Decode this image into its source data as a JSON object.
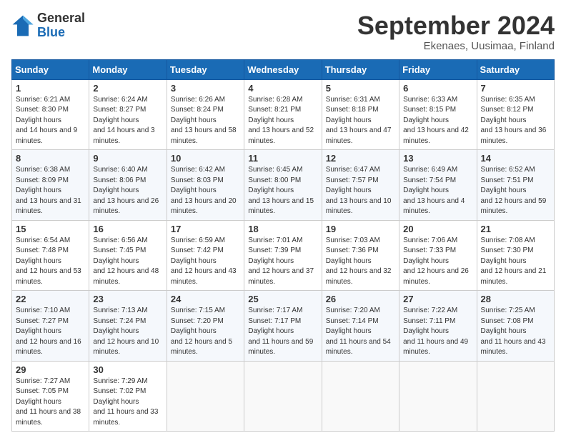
{
  "logo": {
    "general": "General",
    "blue": "Blue"
  },
  "title": {
    "month": "September 2024",
    "location": "Ekenaes, Uusimaa, Finland"
  },
  "headers": [
    "Sunday",
    "Monday",
    "Tuesday",
    "Wednesday",
    "Thursday",
    "Friday",
    "Saturday"
  ],
  "weeks": [
    [
      {
        "day": 1,
        "sunrise": "6:21 AM",
        "sunset": "8:30 PM",
        "daylight": "14 hours and 9 minutes."
      },
      {
        "day": 2,
        "sunrise": "6:24 AM",
        "sunset": "8:27 PM",
        "daylight": "14 hours and 3 minutes."
      },
      {
        "day": 3,
        "sunrise": "6:26 AM",
        "sunset": "8:24 PM",
        "daylight": "13 hours and 58 minutes."
      },
      {
        "day": 4,
        "sunrise": "6:28 AM",
        "sunset": "8:21 PM",
        "daylight": "13 hours and 52 minutes."
      },
      {
        "day": 5,
        "sunrise": "6:31 AM",
        "sunset": "8:18 PM",
        "daylight": "13 hours and 47 minutes."
      },
      {
        "day": 6,
        "sunrise": "6:33 AM",
        "sunset": "8:15 PM",
        "daylight": "13 hours and 42 minutes."
      },
      {
        "day": 7,
        "sunrise": "6:35 AM",
        "sunset": "8:12 PM",
        "daylight": "13 hours and 36 minutes."
      }
    ],
    [
      {
        "day": 8,
        "sunrise": "6:38 AM",
        "sunset": "8:09 PM",
        "daylight": "13 hours and 31 minutes."
      },
      {
        "day": 9,
        "sunrise": "6:40 AM",
        "sunset": "8:06 PM",
        "daylight": "13 hours and 26 minutes."
      },
      {
        "day": 10,
        "sunrise": "6:42 AM",
        "sunset": "8:03 PM",
        "daylight": "13 hours and 20 minutes."
      },
      {
        "day": 11,
        "sunrise": "6:45 AM",
        "sunset": "8:00 PM",
        "daylight": "13 hours and 15 minutes."
      },
      {
        "day": 12,
        "sunrise": "6:47 AM",
        "sunset": "7:57 PM",
        "daylight": "13 hours and 10 minutes."
      },
      {
        "day": 13,
        "sunrise": "6:49 AM",
        "sunset": "7:54 PM",
        "daylight": "13 hours and 4 minutes."
      },
      {
        "day": 14,
        "sunrise": "6:52 AM",
        "sunset": "7:51 PM",
        "daylight": "12 hours and 59 minutes."
      }
    ],
    [
      {
        "day": 15,
        "sunrise": "6:54 AM",
        "sunset": "7:48 PM",
        "daylight": "12 hours and 53 minutes."
      },
      {
        "day": 16,
        "sunrise": "6:56 AM",
        "sunset": "7:45 PM",
        "daylight": "12 hours and 48 minutes."
      },
      {
        "day": 17,
        "sunrise": "6:59 AM",
        "sunset": "7:42 PM",
        "daylight": "12 hours and 43 minutes."
      },
      {
        "day": 18,
        "sunrise": "7:01 AM",
        "sunset": "7:39 PM",
        "daylight": "12 hours and 37 minutes."
      },
      {
        "day": 19,
        "sunrise": "7:03 AM",
        "sunset": "7:36 PM",
        "daylight": "12 hours and 32 minutes."
      },
      {
        "day": 20,
        "sunrise": "7:06 AM",
        "sunset": "7:33 PM",
        "daylight": "12 hours and 26 minutes."
      },
      {
        "day": 21,
        "sunrise": "7:08 AM",
        "sunset": "7:30 PM",
        "daylight": "12 hours and 21 minutes."
      }
    ],
    [
      {
        "day": 22,
        "sunrise": "7:10 AM",
        "sunset": "7:27 PM",
        "daylight": "12 hours and 16 minutes."
      },
      {
        "day": 23,
        "sunrise": "7:13 AM",
        "sunset": "7:24 PM",
        "daylight": "12 hours and 10 minutes."
      },
      {
        "day": 24,
        "sunrise": "7:15 AM",
        "sunset": "7:20 PM",
        "daylight": "12 hours and 5 minutes."
      },
      {
        "day": 25,
        "sunrise": "7:17 AM",
        "sunset": "7:17 PM",
        "daylight": "11 hours and 59 minutes."
      },
      {
        "day": 26,
        "sunrise": "7:20 AM",
        "sunset": "7:14 PM",
        "daylight": "11 hours and 54 minutes."
      },
      {
        "day": 27,
        "sunrise": "7:22 AM",
        "sunset": "7:11 PM",
        "daylight": "11 hours and 49 minutes."
      },
      {
        "day": 28,
        "sunrise": "7:25 AM",
        "sunset": "7:08 PM",
        "daylight": "11 hours and 43 minutes."
      }
    ],
    [
      {
        "day": 29,
        "sunrise": "7:27 AM",
        "sunset": "7:05 PM",
        "daylight": "11 hours and 38 minutes."
      },
      {
        "day": 30,
        "sunrise": "7:29 AM",
        "sunset": "7:02 PM",
        "daylight": "11 hours and 33 minutes."
      },
      null,
      null,
      null,
      null,
      null
    ]
  ]
}
